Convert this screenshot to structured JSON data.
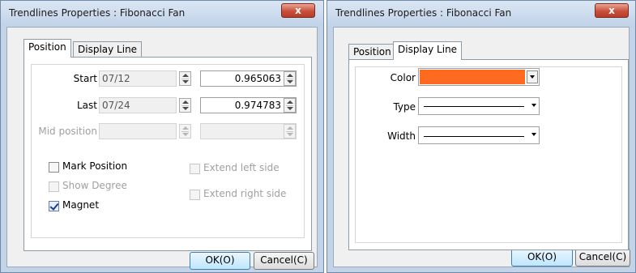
{
  "dialog1": {
    "title": "Trendlines Properties : Fibonacci Fan",
    "close": "x",
    "tabs": [
      "Position",
      "Display Line"
    ],
    "start": {
      "label": "Start",
      "date": "07/12",
      "value": "0.965063"
    },
    "last": {
      "label": "Last",
      "date": "07/24",
      "value": "0.974783"
    },
    "mid": {
      "label": "Mid position",
      "date": "",
      "value": ""
    },
    "mark_position": {
      "label": "Mark Position",
      "checked": false
    },
    "show_degree": {
      "label": "Show Degree",
      "checked": false,
      "enabled": false
    },
    "magnet": {
      "label": "Magnet",
      "checked": true
    },
    "extend_left": {
      "label": "Extend left side",
      "checked": false,
      "enabled": false
    },
    "extend_right": {
      "label": "Extend right side",
      "checked": false,
      "enabled": false
    },
    "ok": "OK(O)",
    "cancel": "Cancel(C)"
  },
  "dialog2": {
    "title": "Trendlines Properties : Fibonacci Fan",
    "close": "x",
    "tabs": [
      "Position",
      "Display Line"
    ],
    "color_label": "Color",
    "color_value": "#ff6a21",
    "type_label": "Type",
    "width_label": "Width",
    "ok": "OK(O)",
    "cancel": "Cancel(C)"
  }
}
